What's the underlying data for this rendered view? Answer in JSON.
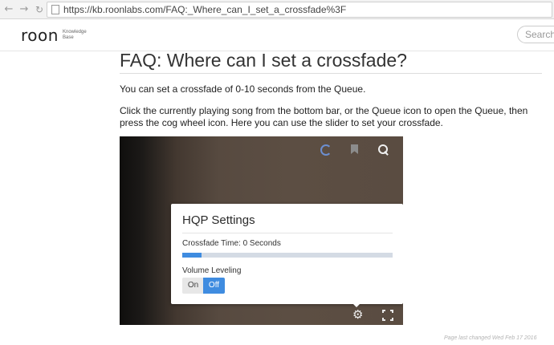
{
  "browser": {
    "url": "https://kb.roonlabs.com/FAQ:_Where_can_I_set_a_crossfade%3F",
    "back_icon": "back-arrow-icon",
    "forward_icon": "forward-arrow-icon",
    "reload_icon": "reload-icon"
  },
  "header": {
    "logo_text": "roon",
    "logo_sub_1": "Knowledge",
    "logo_sub_2": "Base",
    "search_placeholder": "Search"
  },
  "article": {
    "title": "FAQ: Where can I set a crossfade?",
    "paragraph_1": "You can set a crossfade of 0-10 seconds from the Queue.",
    "paragraph_2": "Click the currently playing song from the bottom bar, or the Queue icon to open the Queue, then press the cog wheel icon. Here you can use the slider to set your crossfade."
  },
  "screenshot": {
    "icons": [
      "spinner-icon",
      "bookmark-icon",
      "search-icon",
      "cog-icon",
      "expand-icon"
    ],
    "dialog": {
      "title": "HQP Settings",
      "crossfade_label": "Crossfade Time: 0 Seconds",
      "crossfade_slider_fraction": 0.09,
      "volume_label": "Volume Leveling",
      "toggle_on": "On",
      "toggle_off": "Off",
      "toggle_selected": "Off"
    },
    "accent_color": "#3f8ce0"
  },
  "footer": {
    "last_changed": "Page last changed Wed Feb 17 2016"
  }
}
